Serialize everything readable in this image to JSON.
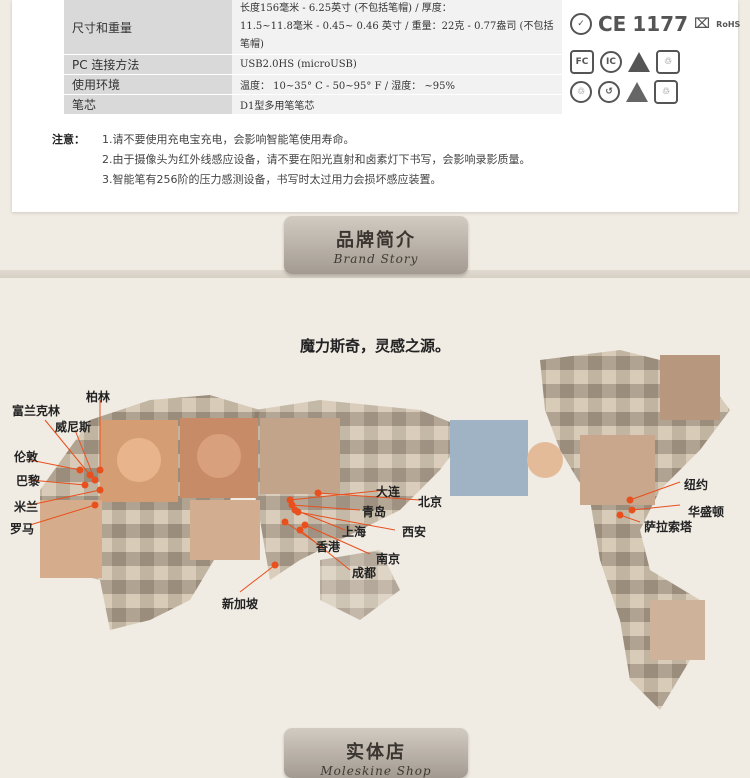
{
  "specs": [
    {
      "label": "尺寸和重量",
      "lines": [
        "长度156毫米 - 6.25英寸 (不包括笔帽) / 厚度：",
        "11.5~11.8毫米 - 0.45~ 0.46 英寸 / 重量：22克 - 0.77盎司 (不包括笔帽)"
      ]
    },
    {
      "label": "PC 连接方法",
      "lines": [
        "USB2.0HS (microUSB)"
      ]
    },
    {
      "label": "使用环境",
      "lines": [
        "温度： 10~35° C - 50~95° F / 湿度： ~95%"
      ]
    },
    {
      "label": "笔芯",
      "lines": [
        "D1型多用笔笔芯"
      ]
    }
  ],
  "certifications": {
    "row1": [
      "CE",
      "1177",
      "RoHS"
    ],
    "row2": [
      "FC",
      "IC",
      "!",
      "♲"
    ],
    "row3": [
      "♲",
      "↺",
      "!",
      "♲"
    ]
  },
  "notes": {
    "label": "注意：",
    "items": [
      "1.请不要使用充电宝充电，会影响智能笔使用寿命。",
      "2.由于摄像头为红外线感应设备，请不要在阳光直射和卤素灯下书写，会影响录影质量。",
      "3.智能笔有256阶的压力感测设备，书写时太过用力会损坏感应装置。"
    ]
  },
  "brand_tab": {
    "cn": "品牌简介",
    "en": "Brand Story"
  },
  "slogan": "魔力斯奇，灵感之源。",
  "cities": [
    "柏林",
    "富兰克林",
    "威尼斯",
    "伦敦",
    "巴黎",
    "米兰",
    "罗马",
    "大连",
    "北京",
    "青岛",
    "上海",
    "西安",
    "香港",
    "南京",
    "成都",
    "新加坡",
    "纽约",
    "华盛顿",
    "萨拉索塔"
  ],
  "shop_tab": {
    "cn": "实体店",
    "en": "Moleskine Shop"
  },
  "colors": {
    "marker": "#e8501e",
    "tab": "#b8b0a5",
    "background": "#f0ebe3"
  }
}
